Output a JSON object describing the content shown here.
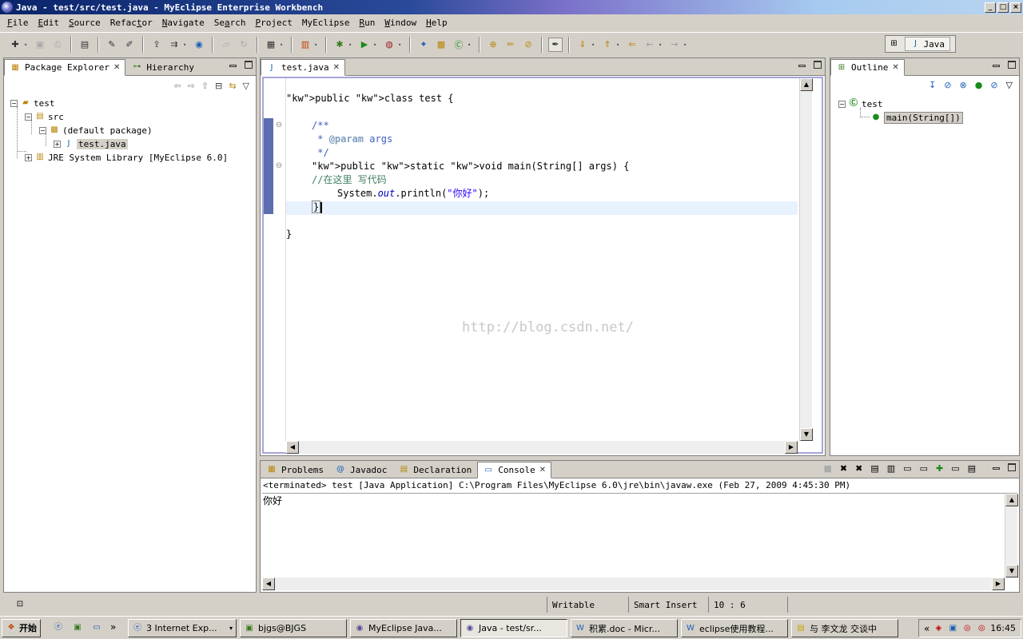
{
  "window": {
    "title": "Java - test/src/test.java - MyEclipse Enterprise Workbench",
    "controls": [
      "_",
      "□",
      "×"
    ]
  },
  "menu": [
    {
      "pre": "",
      "acc": "F",
      "post": "ile"
    },
    {
      "pre": "",
      "acc": "E",
      "post": "dit"
    },
    {
      "pre": "",
      "acc": "S",
      "post": "ource"
    },
    {
      "pre": "Refac",
      "acc": "t",
      "post": "or"
    },
    {
      "pre": "",
      "acc": "N",
      "post": "avigate"
    },
    {
      "pre": "Se",
      "acc": "a",
      "post": "rch"
    },
    {
      "pre": "",
      "acc": "P",
      "post": "roject"
    },
    {
      "pre": "MyEclipse",
      "acc": "",
      "post": ""
    },
    {
      "pre": "",
      "acc": "R",
      "post": "un"
    },
    {
      "pre": "",
      "acc": "W",
      "post": "indow"
    },
    {
      "pre": "",
      "acc": "H",
      "post": "elp"
    }
  ],
  "perspective": {
    "label": "Java"
  },
  "package_explorer": {
    "tabs": [
      "Package Explorer",
      "Hierarchy"
    ],
    "tree": {
      "project": "test",
      "src": "src",
      "package": "(default package)",
      "file": "test.java",
      "library": "JRE System Library [MyEclipse 6.0]"
    }
  },
  "editor": {
    "tab": "test.java",
    "lines": [
      "public class test {",
      "/**",
      " * @param args",
      " */",
      "public static void main(String[] args) {",
      "//在这里 写代码",
      "System.out.println(\"你好\");",
      "}",
      "}"
    ],
    "watermark": "http://blog.csdn.net/"
  },
  "outline": {
    "tab": "Outline",
    "class": "test",
    "method": "main(String[])"
  },
  "console": {
    "tabs": [
      "Problems",
      "Javadoc",
      "Declaration",
      "Console"
    ],
    "header": "<terminated> test [Java Application] C:\\Program Files\\MyEclipse 6.0\\jre\\bin\\javaw.exe (Feb 27, 2009 4:45:30 PM)",
    "output": "你好"
  },
  "status": {
    "writable": "Writable",
    "insert": "Smart Insert",
    "position": "10 : 6"
  },
  "taskbar": {
    "start": "开始",
    "tasks": [
      "3 Internet Exp...",
      "bjgs@BJGS",
      "MyEclipse Java...",
      "Java - test/sr...",
      "积累.doc - Micr...",
      "eclipse使用教程...",
      "与 李文龙 交谈中"
    ],
    "clock": "16:45"
  }
}
